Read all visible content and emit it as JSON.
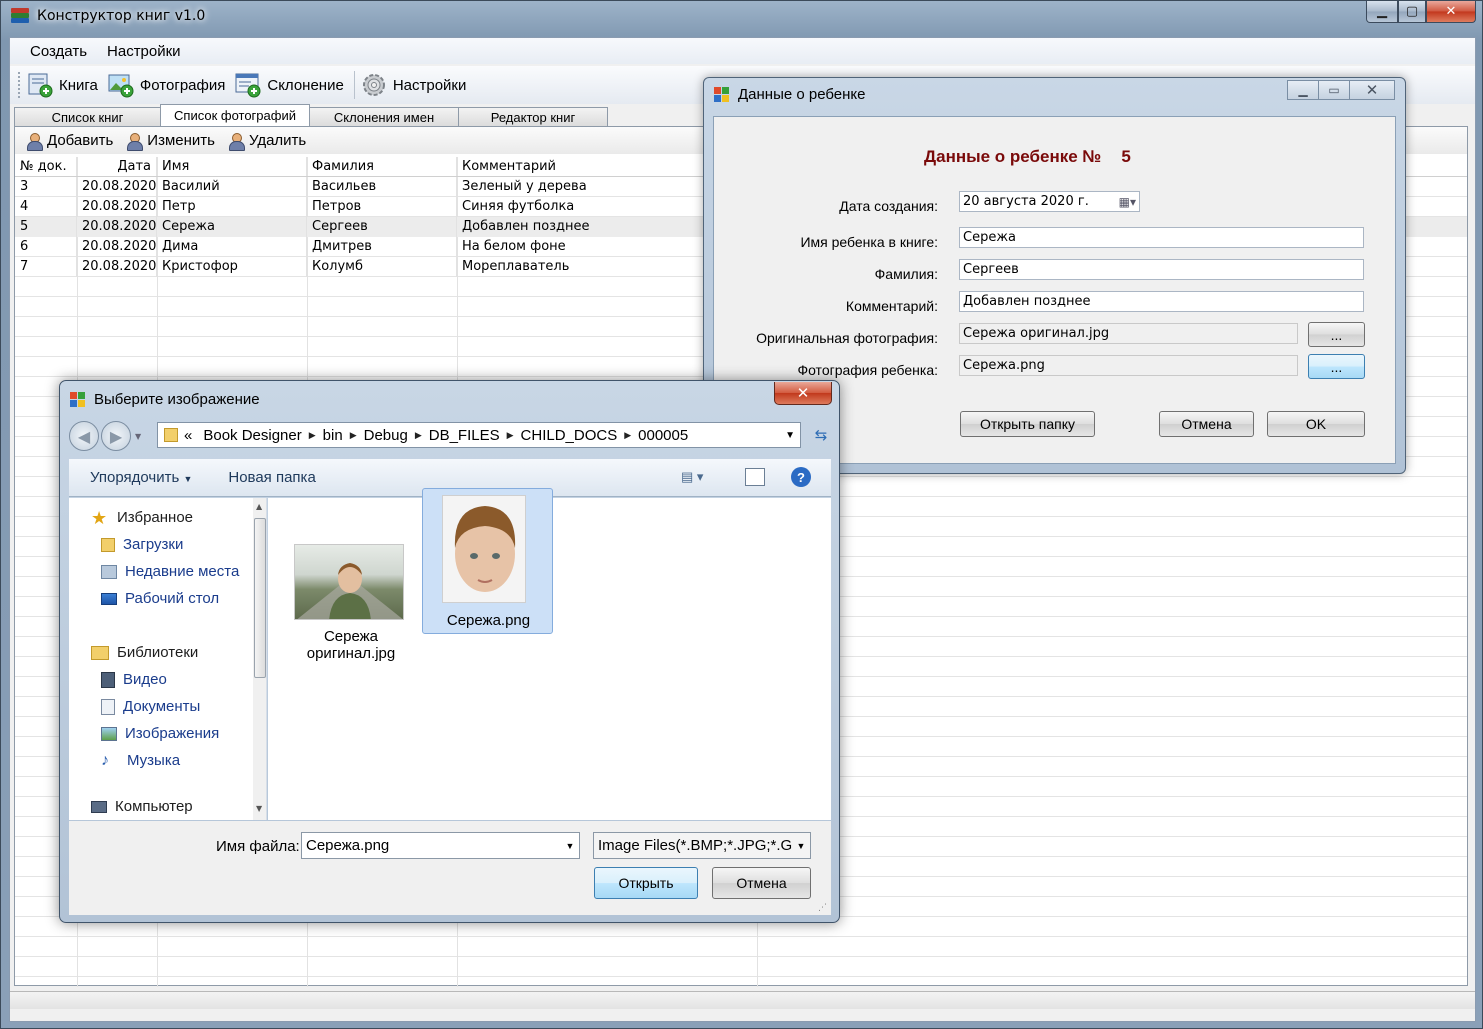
{
  "main": {
    "title": "Конструктор книг v1.0",
    "menu": [
      "Создать",
      "Настройки"
    ],
    "toolbar": [
      "Книга",
      "Фотография",
      "Склонение",
      "Настройки"
    ],
    "tabs": [
      "Список книг",
      "Список фотографий",
      "Склонения имен",
      "Редактор книг"
    ],
    "actions": [
      "Добавить",
      "Изменить",
      "Удалить"
    ],
    "columns": [
      "№ док.",
      "Дата",
      "Имя",
      "Фамилия",
      "Комментарий"
    ],
    "rows": [
      [
        "3",
        "20.08.2020",
        "Василий",
        "Васильев",
        "Зеленый у дерева"
      ],
      [
        "4",
        "20.08.2020",
        "Петр",
        "Петров",
        "Синяя футболка"
      ],
      [
        "5",
        "20.08.2020",
        "Сережа",
        "Сергеев",
        "Добавлен позднее"
      ],
      [
        "6",
        "20.08.2020",
        "Дима",
        "Дмитрев",
        "На белом фоне"
      ],
      [
        "7",
        "20.08.2020",
        "Кристофор",
        "Колумб",
        "Мореплаватель"
      ]
    ]
  },
  "child_dialog": {
    "title": "Данные о ребенке",
    "heading": "Данные о ребенке №",
    "number": "5",
    "labels": {
      "created": "Дата создания:",
      "name": "Имя ребенка в книге:",
      "surname": "Фамилия:",
      "comment": "Комментарий:",
      "original": "Оригинальная фотография:",
      "photo": "Фотография ребенка:"
    },
    "values": {
      "created": "20  августа  2020 г.",
      "name": "Сережа",
      "surname": "Сергеев",
      "comment": "Добавлен позднее",
      "original": "Сережа оригинал.jpg",
      "photo": "Сережа.png"
    },
    "browse": "...",
    "buttons": {
      "open_folder": "Открыть папку",
      "cancel": "Отмена",
      "ok": "OK"
    }
  },
  "file_dialog": {
    "title": "Выберите изображение",
    "path_prefix": "«",
    "path": [
      "Book Designer",
      "bin",
      "Debug",
      "DB_FILES",
      "CHILD_DOCS",
      "000005"
    ],
    "organize": "Упорядочить",
    "new_folder": "Новая папка",
    "nav": {
      "favorites": "Избранное",
      "downloads": "Загрузки",
      "recent": "Недавние места",
      "desktop": "Рабочий стол",
      "libraries": "Библиотеки",
      "video": "Видео",
      "documents": "Документы",
      "images": "Изображения",
      "music": "Музыка",
      "computer": "Компьютер"
    },
    "files": [
      {
        "name_line1": "Сережа",
        "name_line2": "оригинал.jpg"
      },
      {
        "name_line1": "Сережа.png",
        "name_line2": ""
      }
    ],
    "filename_label": "Имя файла:",
    "filename": "Сережа.png",
    "filter": "Image Files(*.BMP;*.JPG;*.GIF;",
    "open": "Открыть",
    "cancel": "Отмена"
  }
}
